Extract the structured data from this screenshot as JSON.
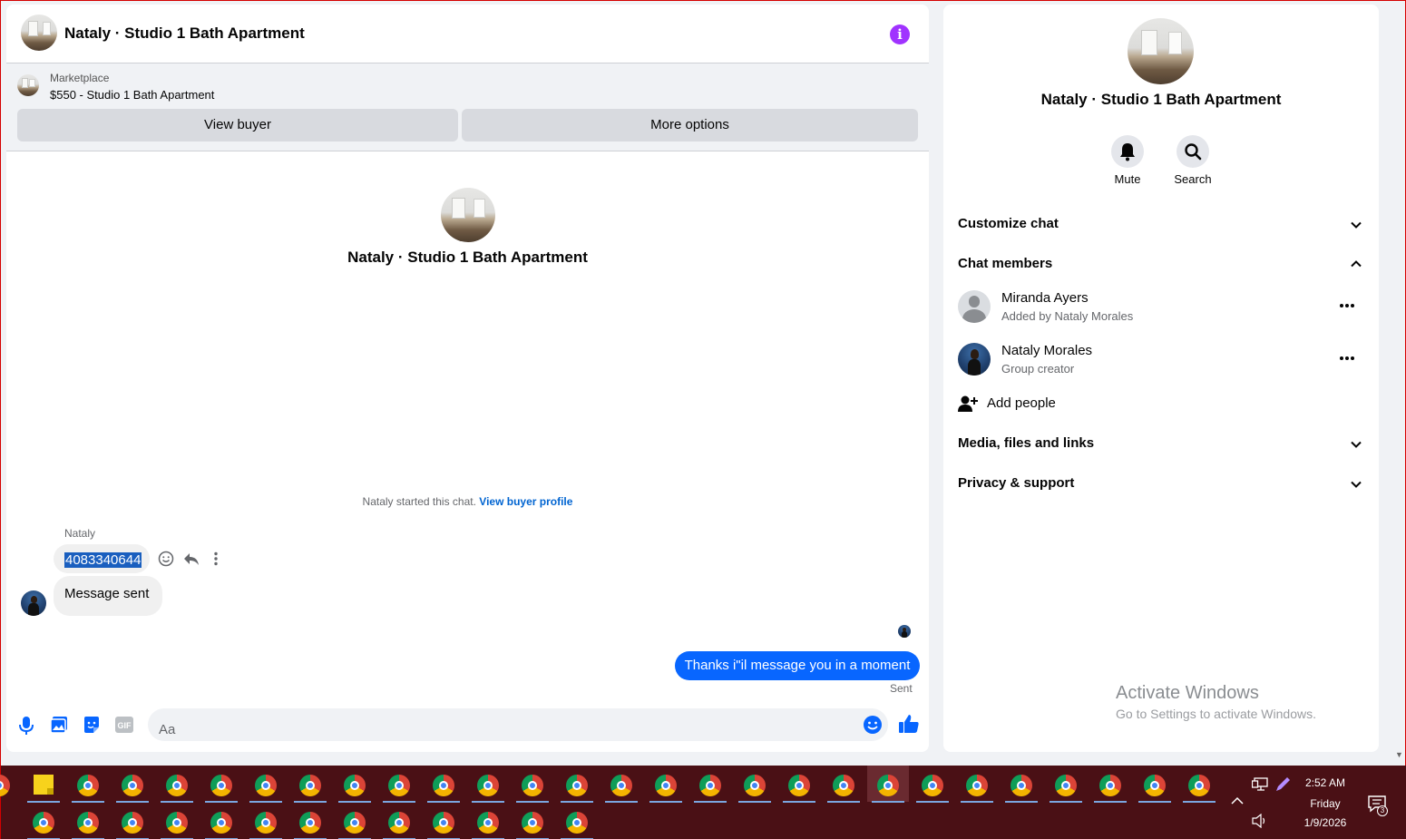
{
  "header": {
    "title": "Nataly · Studio 1 Bath Apartment",
    "info_icon": "info-icon",
    "info_glyph": "i",
    "accent_color": "#a033ff"
  },
  "marketplace": {
    "label": "Marketplace",
    "item": "$550 - Studio 1 Bath Apartment",
    "view_buyer": "View buyer",
    "more_options": "More options"
  },
  "thread": {
    "title": "Nataly · Studio 1 Bath Apartment",
    "started_text": "Nataly started this chat.",
    "started_link": "View buyer profile",
    "messages": [
      {
        "sender": "Nataly",
        "text": "4083340644",
        "direction": "incoming",
        "selected": true
      },
      {
        "text": "Message sent",
        "direction": "incoming"
      },
      {
        "text": "Thanks i\"il message you in a moment",
        "direction": "outgoing",
        "status": "Sent",
        "color": "#0866ff"
      }
    ]
  },
  "composer": {
    "placeholder": "Aa",
    "icons": [
      "microphone-icon",
      "photo-icon",
      "sticker-icon",
      "gif-icon",
      "emoji-icon",
      "like-icon"
    ]
  },
  "info_panel": {
    "name": "Nataly · Studio 1 Bath Apartment",
    "actions": [
      {
        "label": "Mute",
        "icon": "bell-icon"
      },
      {
        "label": "Search",
        "icon": "search-icon"
      }
    ],
    "sections": {
      "customize": "Customize chat",
      "members": "Chat members",
      "media": "Media, files and links",
      "privacy": "Privacy & support"
    },
    "members": [
      {
        "name": "Miranda Ayers",
        "subtitle": "Added by Nataly Morales"
      },
      {
        "name": "Nataly Morales",
        "subtitle": "Group creator"
      }
    ],
    "add_people": "Add people"
  },
  "watermark": {
    "title": "Activate Windows",
    "subtitle": "Go to Settings to activate Windows."
  },
  "taskbar": {
    "time": "2:52 AM",
    "day": "Friday",
    "date": "1/9/2026",
    "notification_count": "3",
    "background_color": "#4a1015"
  }
}
